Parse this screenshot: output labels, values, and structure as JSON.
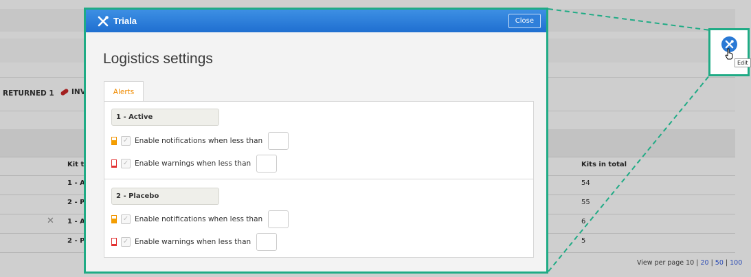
{
  "background": {
    "status": {
      "returned": "RETURNED 1",
      "invalid_fragment": "INV"
    },
    "table": {
      "headers": {
        "kit_type": "Kit ty",
        "kits_in_total": "Kits in total"
      },
      "rows": [
        {
          "kit_type": "1 - A",
          "kits_in_total": "54"
        },
        {
          "kit_type": "2 - P",
          "kits_in_total": "55"
        },
        {
          "kit_type": "1 - A",
          "kits_in_total": "6"
        },
        {
          "kit_type": "2 - P",
          "kits_in_total": "5"
        }
      ]
    },
    "pager": {
      "label": "View per page 10",
      "sep": " | ",
      "opt20": "20",
      "opt50": "50",
      "opt100": "100"
    }
  },
  "zoom": {
    "tooltip": "Edit"
  },
  "modal": {
    "brand": "Triala",
    "close_label": "Close",
    "title": "Logistics settings",
    "tab": "Alerts",
    "groups": [
      {
        "label": "1 - Active",
        "notify_label": "Enable notifications when less than",
        "warn_label": "Enable warnings when less than",
        "notify_value": "",
        "warn_value": ""
      },
      {
        "label": "2 - Placebo",
        "notify_label": "Enable notifications when less than",
        "warn_label": "Enable warnings when less than",
        "notify_value": "",
        "warn_value": ""
      }
    ]
  },
  "colors": {
    "accent_teal": "#1fab85",
    "header_blue": "#2a79d5",
    "tab_orange": "#f08b00",
    "notify_orange": "#f4a000",
    "warn_red": "#e23030",
    "link_blue": "#2a4bb5"
  },
  "icons": {
    "brand": "tools-icon",
    "edit": "tools-icon",
    "cursor": "hand-pointer-icon",
    "notify_indicator": "battery-half-icon",
    "warn_indicator": "battery-low-icon",
    "invalid": "pill-icon"
  }
}
